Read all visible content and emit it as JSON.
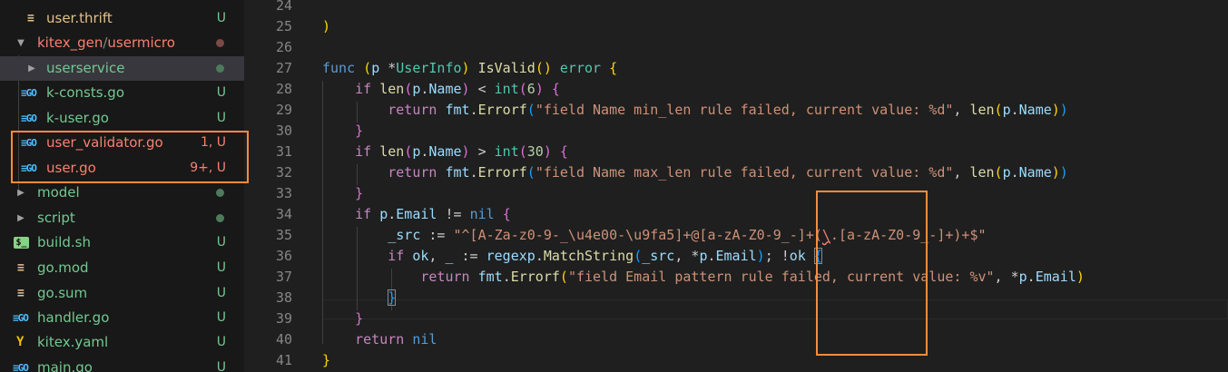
{
  "colors": {
    "keyword": "#569cd6",
    "control": "#c586c0",
    "type": "#4ec9b0",
    "function": "#dcdcaa",
    "variable": "#9cdcfe",
    "string": "#ce9178",
    "number": "#b5cea8",
    "text": "#cccccc",
    "bracket1": "#ffd700",
    "bracket2": "#da70d6",
    "bracket3": "#179fff",
    "untracked": "#73c991",
    "error": "#f88070",
    "annotation": "#ff8c3a"
  },
  "sidebar": {
    "items": [
      {
        "name": "user.thrift",
        "status": "U",
        "icon": "thrift-icon"
      },
      {
        "name": "kitex_gen",
        "sep": "/",
        "name2": "usermicro",
        "icon": "chevron-down-icon"
      },
      {
        "name": "userservice",
        "icon": "chevron-right-icon"
      },
      {
        "name": "k-consts.go",
        "status": "U",
        "icon": "go-file-icon",
        "glyph": "≡GO"
      },
      {
        "name": "k-user.go",
        "status": "U",
        "icon": "go-file-icon",
        "glyph": "≡GO"
      },
      {
        "name": "user_validator.go",
        "status": "1, U",
        "icon": "go-file-icon",
        "glyph": "≡GO"
      },
      {
        "name": "user.go",
        "status": "9+, U",
        "icon": "go-file-icon",
        "glyph": "≡GO"
      },
      {
        "name": "model",
        "icon": "chevron-right-icon"
      },
      {
        "name": "script",
        "icon": "chevron-right-icon"
      },
      {
        "name": "build.sh",
        "status": "U",
        "icon": "shell-file-icon",
        "glyph": "$_"
      },
      {
        "name": "go.mod",
        "status": "U",
        "icon": "go-mod-icon",
        "glyph": "≡"
      },
      {
        "name": "go.sum",
        "status": "U",
        "icon": "go-sum-icon",
        "glyph": "≡"
      },
      {
        "name": "handler.go",
        "status": "U",
        "icon": "go-file-icon",
        "glyph": "≡GO"
      },
      {
        "name": "kitex.yaml",
        "status": "U",
        "icon": "yaml-file-icon",
        "glyph": "Y"
      },
      {
        "name": "main.go",
        "status": "U",
        "icon": "go-file-icon",
        "glyph": "≡GO"
      }
    ]
  },
  "editor": {
    "line_numbers": [
      "24",
      "25",
      "26",
      "27",
      "28",
      "29",
      "30",
      "31",
      "32",
      "33",
      "34",
      "35",
      "36",
      "37",
      "38",
      "39",
      "40",
      "41"
    ],
    "lines": [
      [],
      [
        [
          "b1",
          ")"
        ]
      ],
      [],
      [
        [
          "kw",
          "func"
        ],
        [
          "t",
          " "
        ],
        [
          "b1",
          "("
        ],
        [
          "var",
          "p"
        ],
        [
          "t",
          " *"
        ],
        [
          "type",
          "UserInfo"
        ],
        [
          "b1",
          ")"
        ],
        [
          "t",
          " "
        ],
        [
          "fn",
          "IsValid"
        ],
        [
          "b1",
          "()"
        ],
        [
          "t",
          " "
        ],
        [
          "type",
          "error"
        ],
        [
          "t",
          " "
        ],
        [
          "b1",
          "{"
        ]
      ],
      [
        [
          "t",
          "    "
        ],
        [
          "ctl",
          "if"
        ],
        [
          "t",
          " "
        ],
        [
          "fn",
          "len"
        ],
        [
          "b2",
          "("
        ],
        [
          "var",
          "p"
        ],
        [
          "t",
          "."
        ],
        [
          "var",
          "Name"
        ],
        [
          "b2",
          ")"
        ],
        [
          "t",
          " < "
        ],
        [
          "type",
          "int"
        ],
        [
          "b2",
          "("
        ],
        [
          "num",
          "6"
        ],
        [
          "b2",
          ")"
        ],
        [
          "t",
          " "
        ],
        [
          "b2",
          "{"
        ]
      ],
      [
        [
          "t",
          "        "
        ],
        [
          "ctl",
          "return"
        ],
        [
          "t",
          " "
        ],
        [
          "var",
          "fmt"
        ],
        [
          "t",
          "."
        ],
        [
          "fn",
          "Errorf"
        ],
        [
          "b3",
          "("
        ],
        [
          "str",
          "\"field Name min_len rule failed, current value: %d\""
        ],
        [
          "t",
          ", "
        ],
        [
          "fn",
          "len"
        ],
        [
          "b1",
          "("
        ],
        [
          "var",
          "p"
        ],
        [
          "t",
          "."
        ],
        [
          "var",
          "Name"
        ],
        [
          "b1",
          ")"
        ],
        [
          "b3",
          ")"
        ]
      ],
      [
        [
          "t",
          "    "
        ],
        [
          "b2",
          "}"
        ]
      ],
      [
        [
          "t",
          "    "
        ],
        [
          "ctl",
          "if"
        ],
        [
          "t",
          " "
        ],
        [
          "fn",
          "len"
        ],
        [
          "b2",
          "("
        ],
        [
          "var",
          "p"
        ],
        [
          "t",
          "."
        ],
        [
          "var",
          "Name"
        ],
        [
          "b2",
          ")"
        ],
        [
          "t",
          " > "
        ],
        [
          "type",
          "int"
        ],
        [
          "b2",
          "("
        ],
        [
          "num",
          "30"
        ],
        [
          "b2",
          ")"
        ],
        [
          "t",
          " "
        ],
        [
          "b2",
          "{"
        ]
      ],
      [
        [
          "t",
          "        "
        ],
        [
          "ctl",
          "return"
        ],
        [
          "t",
          " "
        ],
        [
          "var",
          "fmt"
        ],
        [
          "t",
          "."
        ],
        [
          "fn",
          "Errorf"
        ],
        [
          "b3",
          "("
        ],
        [
          "str",
          "\"field Name max_len rule failed, current value: %d\""
        ],
        [
          "t",
          ", "
        ],
        [
          "fn",
          "len"
        ],
        [
          "b1",
          "("
        ],
        [
          "var",
          "p"
        ],
        [
          "t",
          "."
        ],
        [
          "var",
          "Name"
        ],
        [
          "b1",
          ")"
        ],
        [
          "b3",
          ")"
        ]
      ],
      [
        [
          "t",
          "    "
        ],
        [
          "b2",
          "}"
        ]
      ],
      [
        [
          "t",
          "    "
        ],
        [
          "ctl",
          "if"
        ],
        [
          "t",
          " "
        ],
        [
          "var",
          "p"
        ],
        [
          "t",
          "."
        ],
        [
          "var",
          "Email"
        ],
        [
          "t",
          " != "
        ],
        [
          "kw",
          "nil"
        ],
        [
          "t",
          " "
        ],
        [
          "b2",
          "{"
        ]
      ],
      [
        [
          "t",
          "        "
        ],
        [
          "var",
          "_src"
        ],
        [
          "t",
          " := "
        ],
        [
          "str",
          "\"^[A-Za-z0-9-_\\u4e00-\\u9fa5]+@[a-zA-Z0-9_-]+("
        ],
        [
          "err",
          "\\"
        ],
        [
          "str",
          ".[a-zA-Z0-9_-]+)+$\""
        ]
      ],
      [
        [
          "t",
          "        "
        ],
        [
          "ctl",
          "if"
        ],
        [
          "t",
          " "
        ],
        [
          "var",
          "ok"
        ],
        [
          "t",
          ", "
        ],
        [
          "var",
          "_"
        ],
        [
          "t",
          " := "
        ],
        [
          "var",
          "regexp"
        ],
        [
          "t",
          "."
        ],
        [
          "fn",
          "MatchString"
        ],
        [
          "b3",
          "("
        ],
        [
          "var",
          "_src"
        ],
        [
          "t",
          ", *"
        ],
        [
          "var",
          "p"
        ],
        [
          "t",
          "."
        ],
        [
          "var",
          "Email"
        ],
        [
          "b3",
          ")"
        ],
        [
          "t",
          "; !"
        ],
        [
          "var",
          "ok"
        ],
        [
          "t",
          " "
        ],
        [
          "b3box",
          "{"
        ]
      ],
      [
        [
          "t",
          "            "
        ],
        [
          "ctl",
          "return"
        ],
        [
          "t",
          " "
        ],
        [
          "var",
          "fmt"
        ],
        [
          "t",
          "."
        ],
        [
          "fn",
          "Errorf"
        ],
        [
          "b1",
          "("
        ],
        [
          "str",
          "\"field Email pattern rule failed, current value: %v\""
        ],
        [
          "t",
          ", *"
        ],
        [
          "var",
          "p"
        ],
        [
          "t",
          "."
        ],
        [
          "var",
          "Email"
        ],
        [
          "b1",
          ")"
        ]
      ],
      [
        [
          "t",
          "        "
        ],
        [
          "b3box",
          "}"
        ]
      ],
      [
        [
          "t",
          "    "
        ],
        [
          "b2",
          "}"
        ]
      ],
      [
        [
          "t",
          "    "
        ],
        [
          "ctl",
          "return"
        ],
        [
          "t",
          " "
        ],
        [
          "kw",
          "nil"
        ]
      ],
      [
        [
          "b1",
          "}"
        ]
      ]
    ]
  }
}
